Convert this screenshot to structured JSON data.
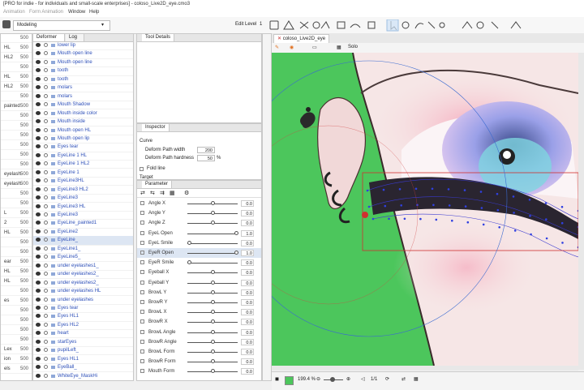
{
  "window": {
    "title": "[PRO for indie - for individuals and small-scale enterprises] - coloso_Live2D_eye.cmo3"
  },
  "menu": {
    "items": [
      "Animation",
      "Form Animation",
      "Window",
      "Help"
    ]
  },
  "toolbar": {
    "mode": "Modeling",
    "edit_level_label": "Edit Level",
    "edit_level_value": "1"
  },
  "deformer_panel": {
    "tabs": [
      "Deformer",
      "Log"
    ],
    "rows": [
      {
        "label": "lower lip"
      },
      {
        "label": "Mouth open    line"
      },
      {
        "label": "Mouth open    line"
      },
      {
        "label": "tooth"
      },
      {
        "label": "tooth"
      },
      {
        "label": "molars"
      },
      {
        "label": "molars"
      },
      {
        "label": "Mouth Shadow"
      },
      {
        "label": "Mouth    inside    color"
      },
      {
        "label": "Mouth    inside"
      },
      {
        "label": "Mouth open HL"
      },
      {
        "label": "Mouth open lip"
      },
      {
        "label": "Eyes    tear"
      },
      {
        "label": "EyeLine 1 HL"
      },
      {
        "label": "EyeLine 1    HL2"
      },
      {
        "label": "EyeLine 1"
      },
      {
        "label": "EyeLine3HL"
      },
      {
        "label": "EyeLine3    HL2"
      },
      {
        "label": "EyeLine3"
      },
      {
        "label": "EyeLine3    HL"
      },
      {
        "label": "EyeLine3"
      },
      {
        "label": "EyeLine_painted1"
      },
      {
        "label": "EyeLine2"
      },
      {
        "label": "EyeLine_"
      },
      {
        "label": "EyeLine1_"
      },
      {
        "label": "EyeLine5_"
      },
      {
        "label": "under    eyelashes1_"
      },
      {
        "label": "under    eyelashes2_"
      },
      {
        "label": "under    eyelashes2_"
      },
      {
        "label": "under    eyelashes    HL"
      },
      {
        "label": "under    eyelashes"
      },
      {
        "label": "Eyes    tear"
      },
      {
        "label": "Eyes    HL1"
      },
      {
        "label": "Eyes    HL2"
      },
      {
        "label": "heart"
      },
      {
        "label": "starEyes"
      },
      {
        "label": "pupilLeft_"
      },
      {
        "label": "Eyes    HL1"
      },
      {
        "label": "EyeBall_"
      },
      {
        "label": "WhiteEye_MaskHi"
      }
    ]
  },
  "parts_panel": {
    "rows": [
      {
        "label": "",
        "value": "500"
      },
      {
        "label": "HL",
        "value": "500"
      },
      {
        "label": "HL2",
        "value": "500"
      },
      {
        "label": "",
        "value": "500"
      },
      {
        "label": "HL",
        "value": "500"
      },
      {
        "label": "HL2",
        "value": "500"
      },
      {
        "label": "",
        "value": "500"
      },
      {
        "label": "painted",
        "value": "500"
      },
      {
        "label": "",
        "value": "500"
      },
      {
        "label": "",
        "value": "500"
      },
      {
        "label": "",
        "value": "500"
      },
      {
        "label": "",
        "value": "500"
      },
      {
        "label": "",
        "value": "500"
      },
      {
        "label": "",
        "value": "500"
      },
      {
        "label": "eyelash",
        "value": "500"
      },
      {
        "label": "eyelash",
        "value": "500"
      },
      {
        "label": "",
        "value": "500"
      },
      {
        "label": "",
        "value": "500"
      },
      {
        "label": "L",
        "value": "500"
      },
      {
        "label": "2",
        "value": "500"
      },
      {
        "label": "HL",
        "value": "500"
      },
      {
        "label": "",
        "value": "500"
      },
      {
        "label": "",
        "value": "500"
      },
      {
        "label": "ear",
        "value": "500"
      },
      {
        "label": "HL",
        "value": "500"
      },
      {
        "label": "HL",
        "value": "500"
      },
      {
        "label": "",
        "value": "500"
      },
      {
        "label": "es",
        "value": "500"
      },
      {
        "label": "",
        "value": "500"
      },
      {
        "label": "",
        "value": "500"
      },
      {
        "label": "",
        "value": "500"
      },
      {
        "label": "",
        "value": "500"
      },
      {
        "label": "Lex",
        "value": "500"
      },
      {
        "label": "ion",
        "value": "500"
      },
      {
        "label": "els",
        "value": "500"
      }
    ]
  },
  "tool_details": {
    "title": "Tool Details"
  },
  "inspector": {
    "tab": "Inspector",
    "section": "Curve",
    "deform_path_width_label": "Deform Path width",
    "deform_path_width_value": "200",
    "deform_path_hardness_label": "Deform Path hardness",
    "deform_path_hardness_value": "50",
    "hardness_unit": "%",
    "fold_line_label": "Fold line",
    "target_label": "Target"
  },
  "parameter_panel": {
    "tab": "Parameter",
    "rows": [
      {
        "name": "Angle X",
        "value": "0.0",
        "knob": 0.5,
        "selected": false
      },
      {
        "name": "Angle Y",
        "value": "0.0",
        "knob": 0.5,
        "selected": false
      },
      {
        "name": "Angle Z",
        "value": "0.0",
        "knob": 0.5,
        "selected": false
      },
      {
        "name": "EyeL Open",
        "value": "1.0",
        "knob": 1.0,
        "selected": false
      },
      {
        "name": "EyeL Smile",
        "value": "0.0",
        "knob": 0.0,
        "selected": false
      },
      {
        "name": "EyeR Open",
        "value": "1.0",
        "knob": 1.0,
        "selected": true
      },
      {
        "name": "EyeR Smile",
        "value": "0.0",
        "knob": 0.0,
        "selected": false
      },
      {
        "name": "Eyeball X",
        "value": "0.0",
        "knob": 0.5,
        "selected": false
      },
      {
        "name": "Eyeball Y",
        "value": "0.0",
        "knob": 0.5,
        "selected": false
      },
      {
        "name": "BrowL Y",
        "value": "0.0",
        "knob": 0.5,
        "selected": false
      },
      {
        "name": "BrowR Y",
        "value": "0.0",
        "knob": 0.5,
        "selected": false
      },
      {
        "name": "BrowL X",
        "value": "0.0",
        "knob": 0.5,
        "selected": false
      },
      {
        "name": "BrowR X",
        "value": "0.0",
        "knob": 0.5,
        "selected": false
      },
      {
        "name": "BrowL Angle",
        "value": "0.0",
        "knob": 0.5,
        "selected": false
      },
      {
        "name": "BrowR Angle",
        "value": "0.0",
        "knob": 0.5,
        "selected": false
      },
      {
        "name": "BrowL Form",
        "value": "0.0",
        "knob": 0.5,
        "selected": false
      },
      {
        "name": "BrowR Form",
        "value": "0.0",
        "knob": 0.5,
        "selected": false
      },
      {
        "name": "Mouth Form",
        "value": "0.0",
        "knob": 0.5,
        "selected": false
      }
    ]
  },
  "viewport": {
    "tab": "coloso_Live2D_eye",
    "solo_label": "Solo",
    "zoom": "199.4 %",
    "page_value": "1/1",
    "colors": {
      "green": "#4cc65c",
      "mesh": "#3a3ad0",
      "mesh_points": "#3040e0",
      "skin": "#f6e6e6",
      "lash": "#2a2530"
    }
  }
}
